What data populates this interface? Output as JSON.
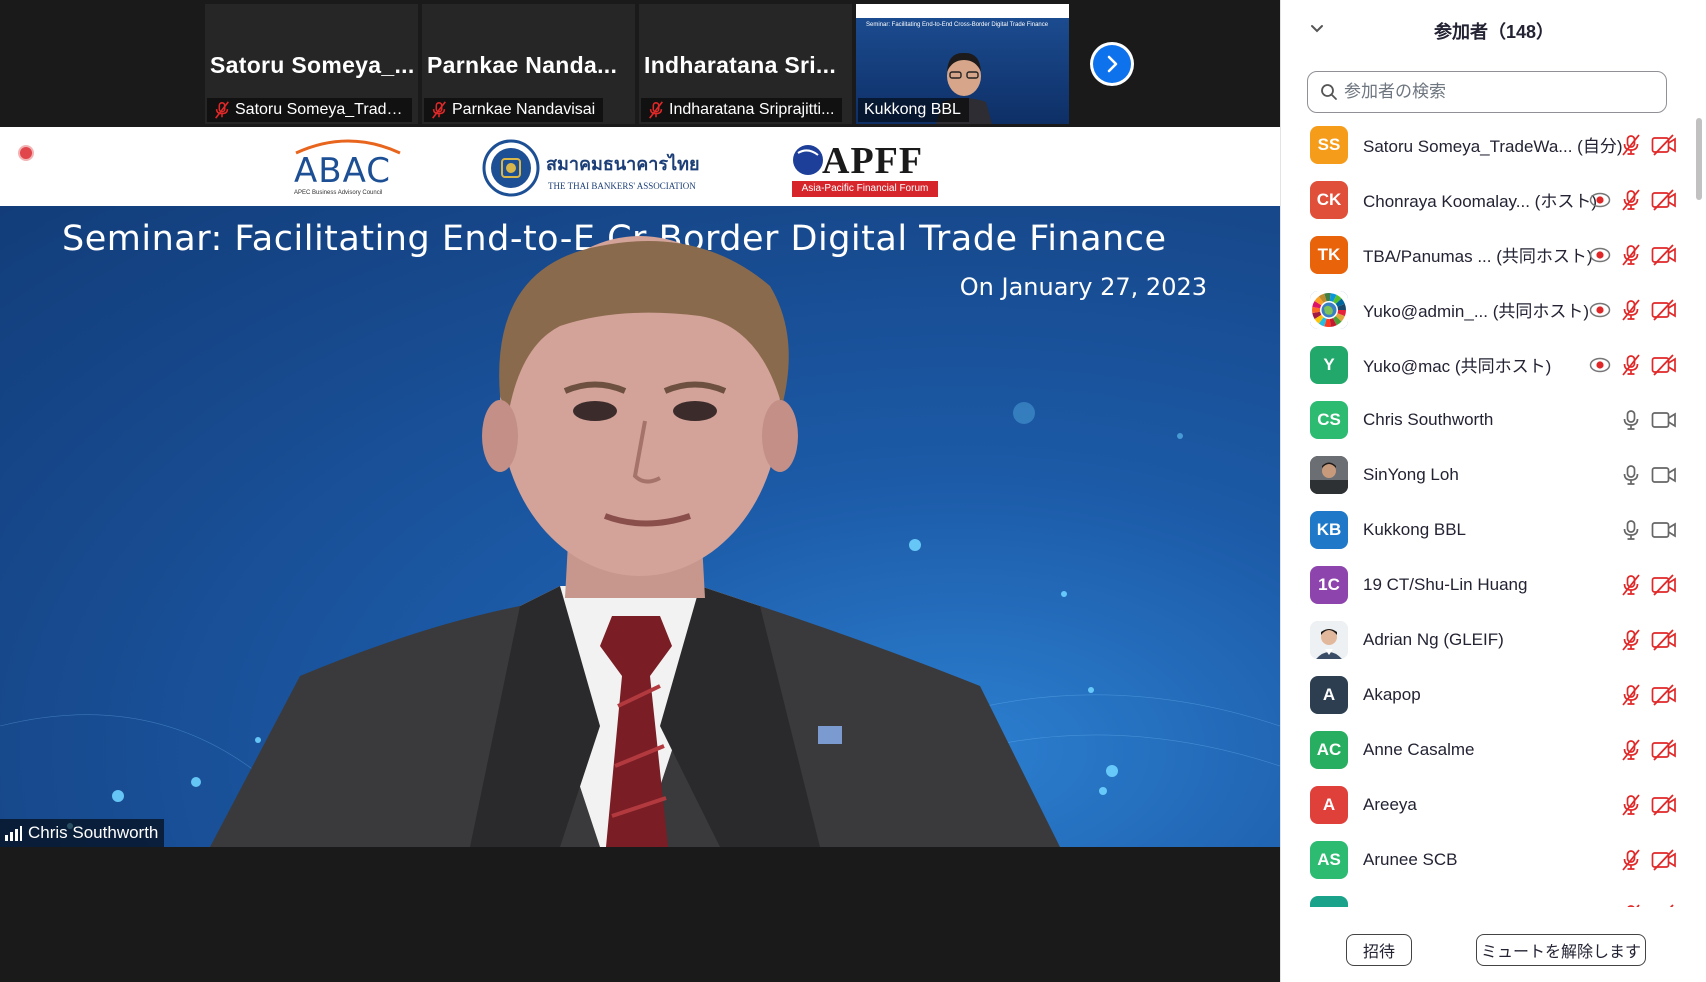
{
  "thumbnails": [
    {
      "big_name": "Satoru  Someya_...",
      "label": "Satoru Someya_Trade...",
      "muted": true
    },
    {
      "big_name": "Parnkae  Nanda...",
      "label": "Parnkae Nandavisai",
      "muted": true
    },
    {
      "big_name": "Indharatana  Sri...",
      "label": "Indharatana Sriprajitti...",
      "muted": true
    },
    {
      "big_name": "",
      "label": "Kukkong BBL",
      "muted": false,
      "mini_title": "Seminar: Facilitating End-to-End Cross-Border Digital Trade Finance"
    }
  ],
  "stage": {
    "logos": {
      "abac": "ABAC",
      "abac_sub": "APEC Business Advisory Council",
      "tba": "สมาคมธนาคารไทย",
      "tba_sub": "THE THAI BANKERS' ASSOCIATION",
      "apff": "APFF",
      "apff_sub": "Asia-Pacific Financial Forum"
    },
    "slide_title": "Seminar: Facilitating End-to-E   Cr   Border Digital Trade Finance",
    "slide_date": "On January 27, 2023",
    "speaker_name": "Chris Southworth"
  },
  "panel": {
    "title": "参加者（148）",
    "search_placeholder": "参加者の検索",
    "participants": [
      {
        "initials": "SS",
        "color": "#f59c1a",
        "name": "Satoru Someya_TradeWa... (自分)",
        "status": "",
        "mic": "off",
        "video": "off",
        "record": false
      },
      {
        "initials": "CK",
        "color": "#e04f39",
        "name": "Chonraya Koomalay... (ホスト)",
        "status": "",
        "mic": "off",
        "video": "off",
        "record": true
      },
      {
        "initials": "TK",
        "color": "#e8630a",
        "name": "TBA/Panumas ...  (共同ホスト)",
        "status": "",
        "mic": "off",
        "video": "off",
        "record": true
      },
      {
        "initials": "",
        "color": "#3b6bb3",
        "name": "Yuko@admin_...  (共同ホスト)",
        "status": "",
        "mic": "off",
        "video": "off",
        "record": true,
        "image": "globe"
      },
      {
        "initials": "Y",
        "color": "#23a86b",
        "name": "Yuko@mac (共同ホスト)",
        "status": "",
        "mic": "off",
        "video": "off",
        "record": true
      },
      {
        "initials": "CS",
        "color": "#2dbb72",
        "name": "Chris Southworth",
        "status": "",
        "mic": "on",
        "video": "on",
        "record": false
      },
      {
        "initials": "",
        "color": "#4a4a4a",
        "name": "SinYong Loh",
        "status": "",
        "mic": "on",
        "video": "on",
        "record": false,
        "image": "photo1"
      },
      {
        "initials": "KB",
        "color": "#1f78c8",
        "name": "Kukkong BBL",
        "status": "",
        "mic": "on",
        "video": "on",
        "record": false
      },
      {
        "initials": "1C",
        "color": "#8e44ad",
        "name": "19 CT/Shu-Lin Huang",
        "status": "",
        "mic": "off",
        "video": "off",
        "record": false
      },
      {
        "initials": "",
        "color": "#d9d9d9",
        "name": "Adrian Ng (GLEIF)",
        "status": "",
        "mic": "off",
        "video": "off",
        "record": false,
        "image": "photo2"
      },
      {
        "initials": "A",
        "color": "#2c3e50",
        "name": "Akapop",
        "status": "",
        "mic": "off",
        "video": "off",
        "record": false
      },
      {
        "initials": "AC",
        "color": "#27ae60",
        "name": "Anne Casalme",
        "status": "",
        "mic": "off",
        "video": "off",
        "record": false
      },
      {
        "initials": "A",
        "color": "#e0403a",
        "name": "Areeya",
        "status": "",
        "mic": "off",
        "video": "off",
        "record": false
      },
      {
        "initials": "AS",
        "color": "#2dbb72",
        "name": "Arunee SCB",
        "status": "",
        "mic": "off",
        "video": "off",
        "record": false
      },
      {
        "initials": "",
        "color": "#1aa38a",
        "name": "",
        "status": "",
        "mic": "off",
        "video": "off",
        "record": false
      }
    ],
    "invite_label": "招待",
    "unmute_label": "ミュートを解除します"
  },
  "colors": {
    "accent": "#0e72ed",
    "muted_red": "#e02828",
    "slide_blue": "#1b4e93"
  }
}
